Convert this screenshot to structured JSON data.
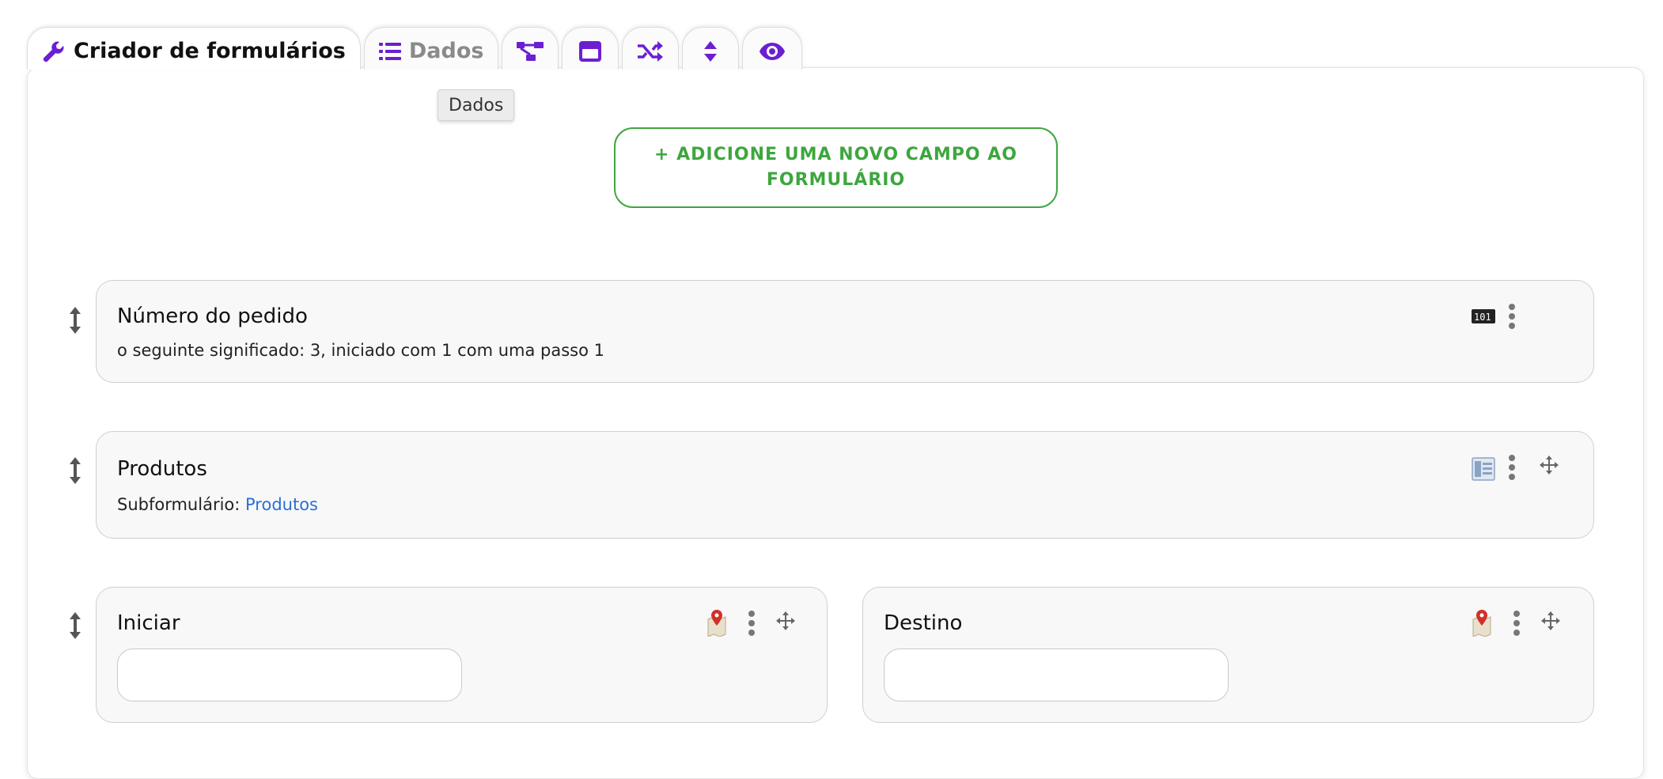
{
  "tabs": [
    {
      "label": "Criador de formulários",
      "icon": "wrench-icon"
    },
    {
      "label": "Dados",
      "icon": "list-icon"
    },
    {
      "icon": "sitemap-icon"
    },
    {
      "icon": "window-icon"
    },
    {
      "icon": "shuffle-icon"
    },
    {
      "icon": "sort-icon"
    },
    {
      "icon": "eye-icon"
    }
  ],
  "tooltip": "Dados",
  "add_field_label": "+ ADICIONE UMA NOVO CAMPO AO FORMULÁRIO",
  "fields": [
    {
      "title": "Número do pedido",
      "description": "o seguinte significado: 3, iniciado com 1 com uma passo 1",
      "type_icon": "counter-icon"
    },
    {
      "title": "Produtos",
      "description_prefix": "Subformulário: ",
      "link": "Produtos",
      "type_icon": "subform-icon"
    },
    {
      "title": "Iniciar",
      "type_icon": "map-pin-icon"
    },
    {
      "title": "Destino",
      "type_icon": "map-pin-icon"
    }
  ],
  "colors": {
    "accent_purple": "#6c1fd1",
    "add_green": "#3ea63e",
    "link_blue": "#2a6fd6"
  }
}
